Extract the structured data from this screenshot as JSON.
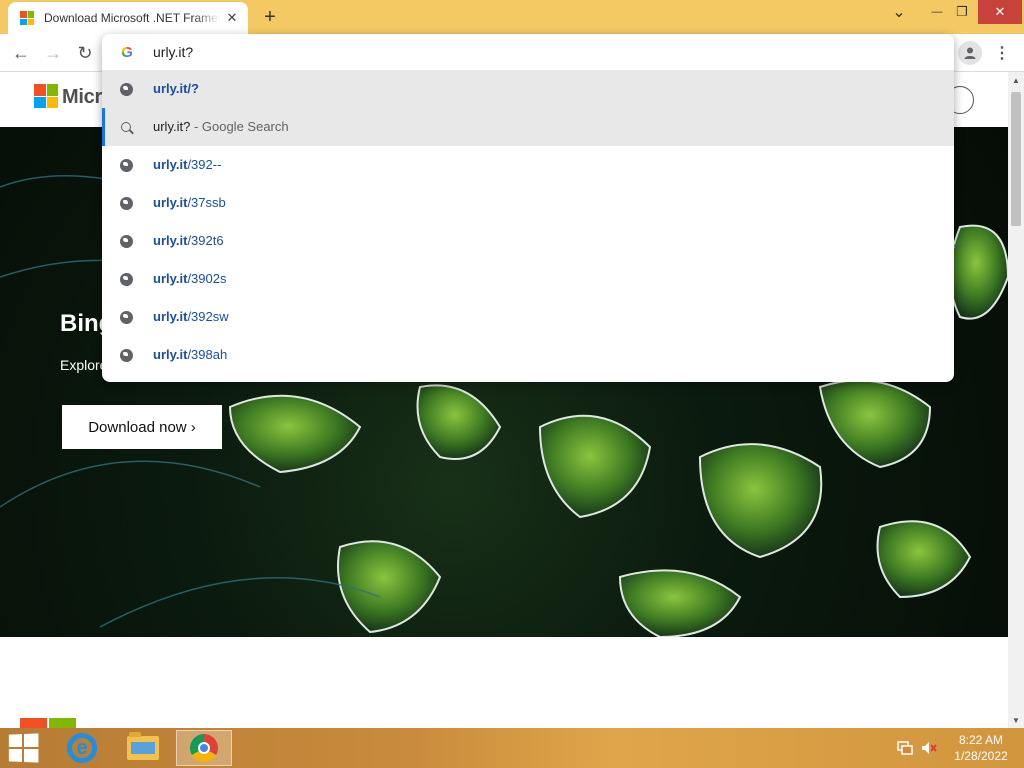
{
  "browser": {
    "tab": {
      "title": "Download Microsoft .NET Framework",
      "close": "✕"
    },
    "newtab_symbol": "+",
    "window_controls": {
      "dropdown": "⌄",
      "minimize": "—",
      "restore": "❐",
      "close": "✕"
    },
    "nav": {
      "back": "←",
      "forward": "→",
      "reload": "↻",
      "menu": "⋮"
    }
  },
  "omnibox": {
    "value": "urly.it?",
    "google_mark": "G",
    "suggestions": [
      {
        "type": "url",
        "bold": "urly.it/?",
        "rest": ""
      },
      {
        "type": "search",
        "query": "urly.it?",
        "desc": " - Google Search"
      },
      {
        "type": "url",
        "bold": "urly.it",
        "rest": "/392--"
      },
      {
        "type": "url",
        "bold": "urly.it",
        "rest": "/37ssb"
      },
      {
        "type": "url",
        "bold": "urly.it",
        "rest": "/392t6"
      },
      {
        "type": "url",
        "bold": "urly.it",
        "rest": "/3902s"
      },
      {
        "type": "url",
        "bold": "urly.it",
        "rest": "/392sw"
      },
      {
        "type": "url",
        "bold": "urly.it",
        "rest": "/398ah"
      }
    ]
  },
  "page": {
    "brand": "Micro",
    "hero": {
      "title": "Bing",
      "description": "Explore background each day",
      "button": "Download now ›"
    }
  },
  "colors": {
    "ms_red": "#f25022",
    "ms_green": "#7fba00",
    "ms_blue": "#00a4ef",
    "ms_yellow": "#ffb900",
    "titlebar": "#f4c964",
    "link_blue": "#1a4fa3",
    "selected_bar": "#1a73e8"
  },
  "taskbar": {
    "apps": [
      "internet-explorer",
      "file-explorer",
      "chrome"
    ],
    "time": "8:22 AM",
    "date": "1/28/2022"
  }
}
